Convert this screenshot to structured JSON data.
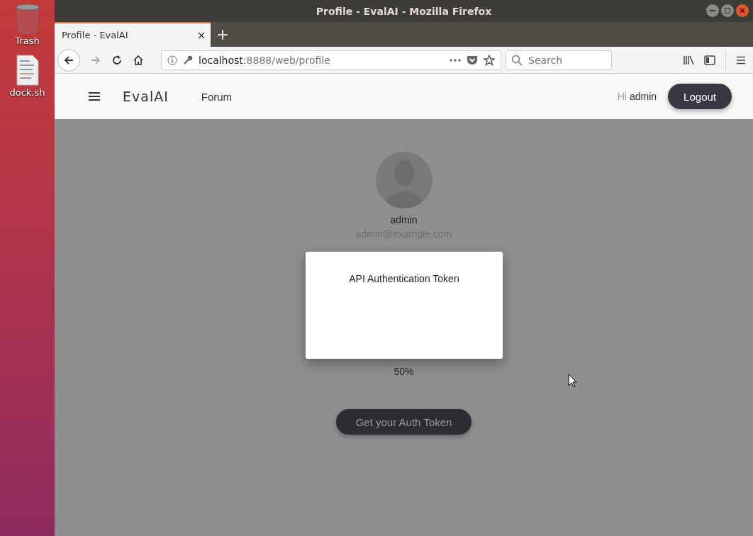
{
  "desktop": {
    "icons": [
      {
        "kind": "trash",
        "label": "Trash"
      },
      {
        "kind": "file",
        "label": "dock.sh"
      }
    ]
  },
  "window": {
    "title": "Profile - EvalAI - Mozilla Firefox"
  },
  "tabs": [
    {
      "label": "Profile - EvalAI",
      "selected": true
    }
  ],
  "new_tab": "+",
  "address_bar": {
    "host": "localhost",
    "rest": ":8888/web/profile"
  },
  "search": {
    "placeholder": "Search"
  },
  "navbar": {
    "logo": "EvalAI",
    "links": [
      "Forum"
    ],
    "greeting": "Hi",
    "user": "admin",
    "logout": "Logout"
  },
  "profile": {
    "name": "admin",
    "email": "admin@example.com",
    "progress_value": "50%",
    "button": "Get your Auth Token"
  },
  "modal": {
    "title": "API Authentication Token"
  }
}
